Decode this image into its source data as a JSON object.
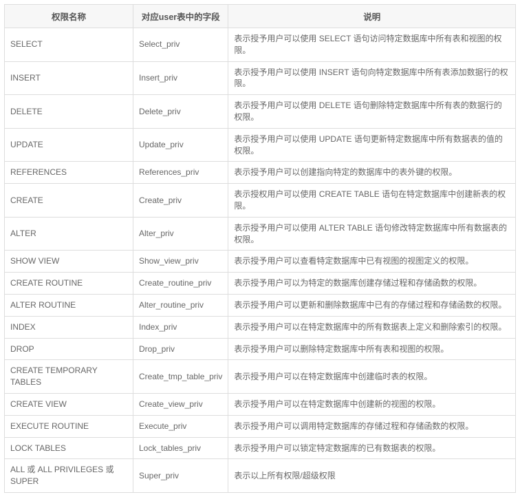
{
  "headers": {
    "name": "权限名称",
    "field": "对应user表中的字段",
    "desc": "说明"
  },
  "rows": [
    {
      "name": "SELECT",
      "field": "Select_priv",
      "desc": "表示授予用户可以使用 SELECT 语句访问特定数据库中所有表和视图的权限。"
    },
    {
      "name": "INSERT",
      "field": "Insert_priv",
      "desc": "表示授予用户可以使用 INSERT 语句向特定数据库中所有表添加数据行的权限。"
    },
    {
      "name": "DELETE",
      "field": "Delete_priv",
      "desc": "表示授予用户可以使用 DELETE 语句删除特定数据库中所有表的数据行的权限。"
    },
    {
      "name": "UPDATE",
      "field": "Update_priv",
      "desc": "表示授予用户可以使用 UPDATE 语句更新特定数据库中所有数据表的值的权限。"
    },
    {
      "name": "REFERENCES",
      "field": "References_priv",
      "desc": "表示授予用户可以创建指向特定的数据库中的表外键的权限。"
    },
    {
      "name": "CREATE",
      "field": "Create_priv",
      "desc": "表示授权用户可以使用 CREATE TABLE 语句在特定数据库中创建新表的权限。"
    },
    {
      "name": "ALTER",
      "field": "Alter_priv",
      "desc": "表示授予用户可以使用 ALTER TABLE 语句修改特定数据库中所有数据表的权限。"
    },
    {
      "name": "SHOW VIEW",
      "field": "Show_view_priv",
      "desc": "表示授予用户可以查看特定数据库中已有视图的视图定义的权限。"
    },
    {
      "name": "CREATE ROUTINE",
      "field": "Create_routine_priv",
      "desc": "表示授予用户可以为特定的数据库创建存储过程和存储函数的权限。"
    },
    {
      "name": "ALTER ROUTINE",
      "field": "Alter_routine_priv",
      "desc": "表示授予用户可以更新和删除数据库中已有的存储过程和存储函数的权限。"
    },
    {
      "name": "INDEX",
      "field": "Index_priv",
      "desc": "表示授予用户可以在特定数据库中的所有数据表上定义和删除索引的权限。"
    },
    {
      "name": "DROP",
      "field": "Drop_priv",
      "desc": "表示授予用户可以删除特定数据库中所有表和视图的权限。"
    },
    {
      "name": "CREATE TEMPORARY TABLES",
      "field": "Create_tmp_table_priv",
      "desc": "表示授予用户可以在特定数据库中创建临时表的权限。"
    },
    {
      "name": "CREATE VIEW",
      "field": "Create_view_priv",
      "desc": "表示授予用户可以在特定数据库中创建新的视图的权限。"
    },
    {
      "name": "EXECUTE ROUTINE",
      "field": "Execute_priv",
      "desc": "表示授予用户可以调用特定数据库的存储过程和存储函数的权限。"
    },
    {
      "name": "LOCK TABLES",
      "field": "Lock_tables_priv",
      "desc": "表示授予用户可以锁定特定数据库的已有数据表的权限。"
    },
    {
      "name": "ALL 或 ALL PRIVILEGES 或 SUPER",
      "field": "Super_priv",
      "desc": "表示以上所有权限/超级权限"
    }
  ]
}
